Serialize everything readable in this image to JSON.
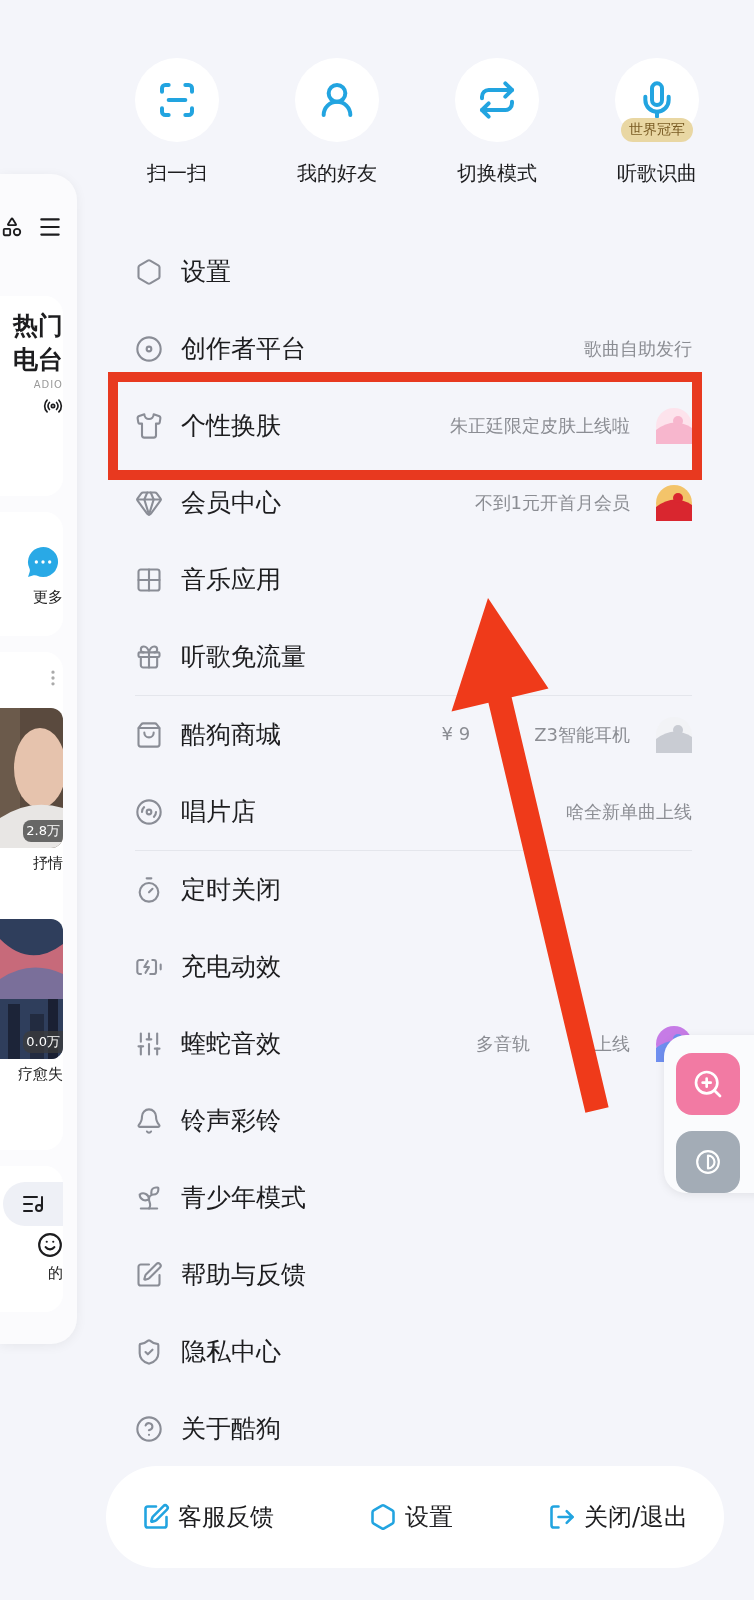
{
  "left_panel": {
    "radio_title": [
      "热门",
      "电台"
    ],
    "radio_subtitle": "ADIO",
    "more_label": "更多",
    "playlists": [
      {
        "count": "2.8万",
        "title": "抒情"
      },
      {
        "count": "0.0万",
        "title": "疗愈失"
      }
    ],
    "bottom_label": "的"
  },
  "quick_actions": [
    {
      "label": "扫一扫"
    },
    {
      "label": "我的好友"
    },
    {
      "label": "切换模式"
    },
    {
      "label": "听歌识曲",
      "badge": "世界冠军"
    }
  ],
  "menu_groups": [
    [
      {
        "label": "设置"
      },
      {
        "label": "创作者平台",
        "subtitle": "歌曲自助发行"
      },
      {
        "label": "个性换肤",
        "subtitle": "朱正廷限定皮肤上线啦",
        "thumbnail": true
      },
      {
        "label": "会员中心",
        "subtitle": "不到1元开首月会员",
        "thumbnail": true
      },
      {
        "label": "音乐应用"
      },
      {
        "label": "听歌免流量"
      }
    ],
    [
      {
        "label": "酷狗商城",
        "subtitle": "¥ 9",
        "subtitle_2": "Z3智能耳机",
        "thumbnail": true
      },
      {
        "label": "唱片店",
        "subtitle": "啥全新单曲上线"
      }
    ],
    [
      {
        "label": "定时关闭"
      },
      {
        "label": "充电动效"
      },
      {
        "label": "蝰蛇音效",
        "subtitle": "多音轨",
        "subtitle_2": "上线",
        "thumbnail": true
      },
      {
        "label": "铃声彩铃"
      },
      {
        "label": "青少年模式"
      },
      {
        "label": "帮助与反馈"
      },
      {
        "label": "隐私中心"
      },
      {
        "label": "关于酷狗"
      }
    ]
  ],
  "bottom_bar": [
    {
      "label": "客服反馈"
    },
    {
      "label": "设置"
    },
    {
      "label": "关闭/退出"
    }
  ],
  "annotations": [
    {
      "kind": "box"
    },
    {
      "kind": "arrow"
    }
  ]
}
